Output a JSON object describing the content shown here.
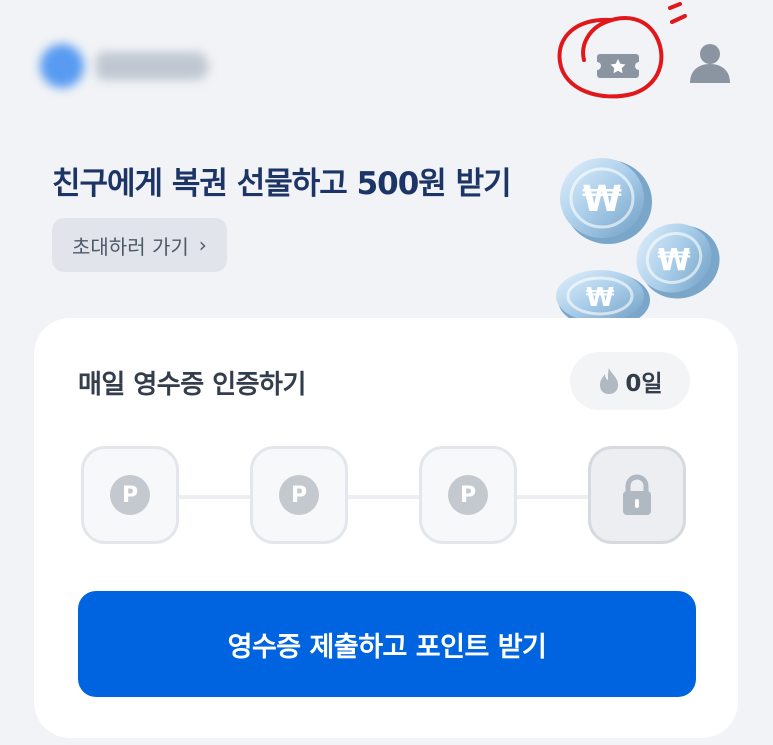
{
  "header": {
    "profile_name": "",
    "icons": {
      "ticket": "ticket-star-icon",
      "user": "user-icon"
    },
    "annotation_color": "#e0181c"
  },
  "promo": {
    "title": "친구에게 복권 선물하고 500원 받기",
    "invite_label": "초대하러 가기",
    "invite_chevron": "›",
    "coin_symbol": "₩"
  },
  "receipt_card": {
    "title": "매일 영수증 인증하기",
    "streak_value": "0일",
    "steps": [
      {
        "label": "P",
        "state": "reward"
      },
      {
        "label": "P",
        "state": "reward"
      },
      {
        "label": "P",
        "state": "reward"
      },
      {
        "label": "",
        "state": "locked"
      }
    ],
    "submit_label": "영수증 제출하고 포인트 받기"
  },
  "colors": {
    "background": "#f1f3f6",
    "primary": "#0064e0",
    "promo_title": "#1d3566",
    "flame": "#b0b8c1"
  }
}
